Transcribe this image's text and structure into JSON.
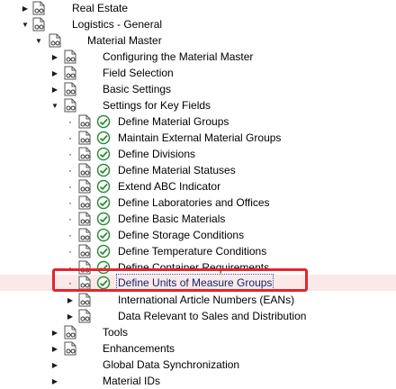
{
  "tree": [
    {
      "label": "Real Estate",
      "toggle": "collapsed",
      "execute": false
    },
    {
      "label": "Logistics - General",
      "toggle": "expanded",
      "execute": false
    },
    {
      "label": "Material Master",
      "toggle": "expanded",
      "execute": false
    },
    {
      "label": "Configuring the Material Master",
      "toggle": "collapsed",
      "execute": false
    },
    {
      "label": "Field Selection",
      "toggle": "collapsed",
      "execute": false
    },
    {
      "label": "Basic Settings",
      "toggle": "collapsed",
      "execute": false
    },
    {
      "label": "Settings for Key Fields",
      "toggle": "expanded",
      "execute": false
    },
    {
      "label": "Define Material Groups",
      "toggle": "bullet",
      "execute": true
    },
    {
      "label": "Maintain External Material Groups",
      "toggle": "bullet",
      "execute": true
    },
    {
      "label": "Define Divisions",
      "toggle": "bullet",
      "execute": true
    },
    {
      "label": "Define Material Statuses",
      "toggle": "bullet",
      "execute": true
    },
    {
      "label": "Extend ABC Indicator",
      "toggle": "bullet",
      "execute": true
    },
    {
      "label": "Define Laboratories and Offices",
      "toggle": "bullet",
      "execute": true
    },
    {
      "label": "Define Basic Materials",
      "toggle": "bullet",
      "execute": true
    },
    {
      "label": "Define Storage Conditions",
      "toggle": "bullet",
      "execute": true
    },
    {
      "label": "Define Temperature Conditions",
      "toggle": "bullet",
      "execute": true
    },
    {
      "label": "Define Container Requirements",
      "toggle": "bullet",
      "execute": true
    },
    {
      "label": "Define Units of Measure Groups",
      "toggle": "bullet",
      "execute": true,
      "selected": true
    },
    {
      "label": "International Article Numbers (EANs)",
      "toggle": "collapsed",
      "execute": false
    },
    {
      "label": "Data Relevant to Sales and Distribution",
      "toggle": "collapsed",
      "execute": false
    },
    {
      "label": "Tools",
      "toggle": "collapsed",
      "execute": false
    },
    {
      "label": "Enhancements",
      "toggle": "collapsed",
      "execute": false
    },
    {
      "label": "Global Data Synchronization",
      "toggle": "collapsed",
      "execute": false
    },
    {
      "label": "Material IDs",
      "toggle": "collapsed",
      "execute": false
    }
  ],
  "colors": {
    "highlight_border": "#e3262b",
    "execute_icon": "#2f8a3a",
    "selected_row_bg": "#fbe9ea"
  },
  "icons": {
    "documentation": "doc-glasses-icon",
    "execute": "execute-clock-icon"
  }
}
